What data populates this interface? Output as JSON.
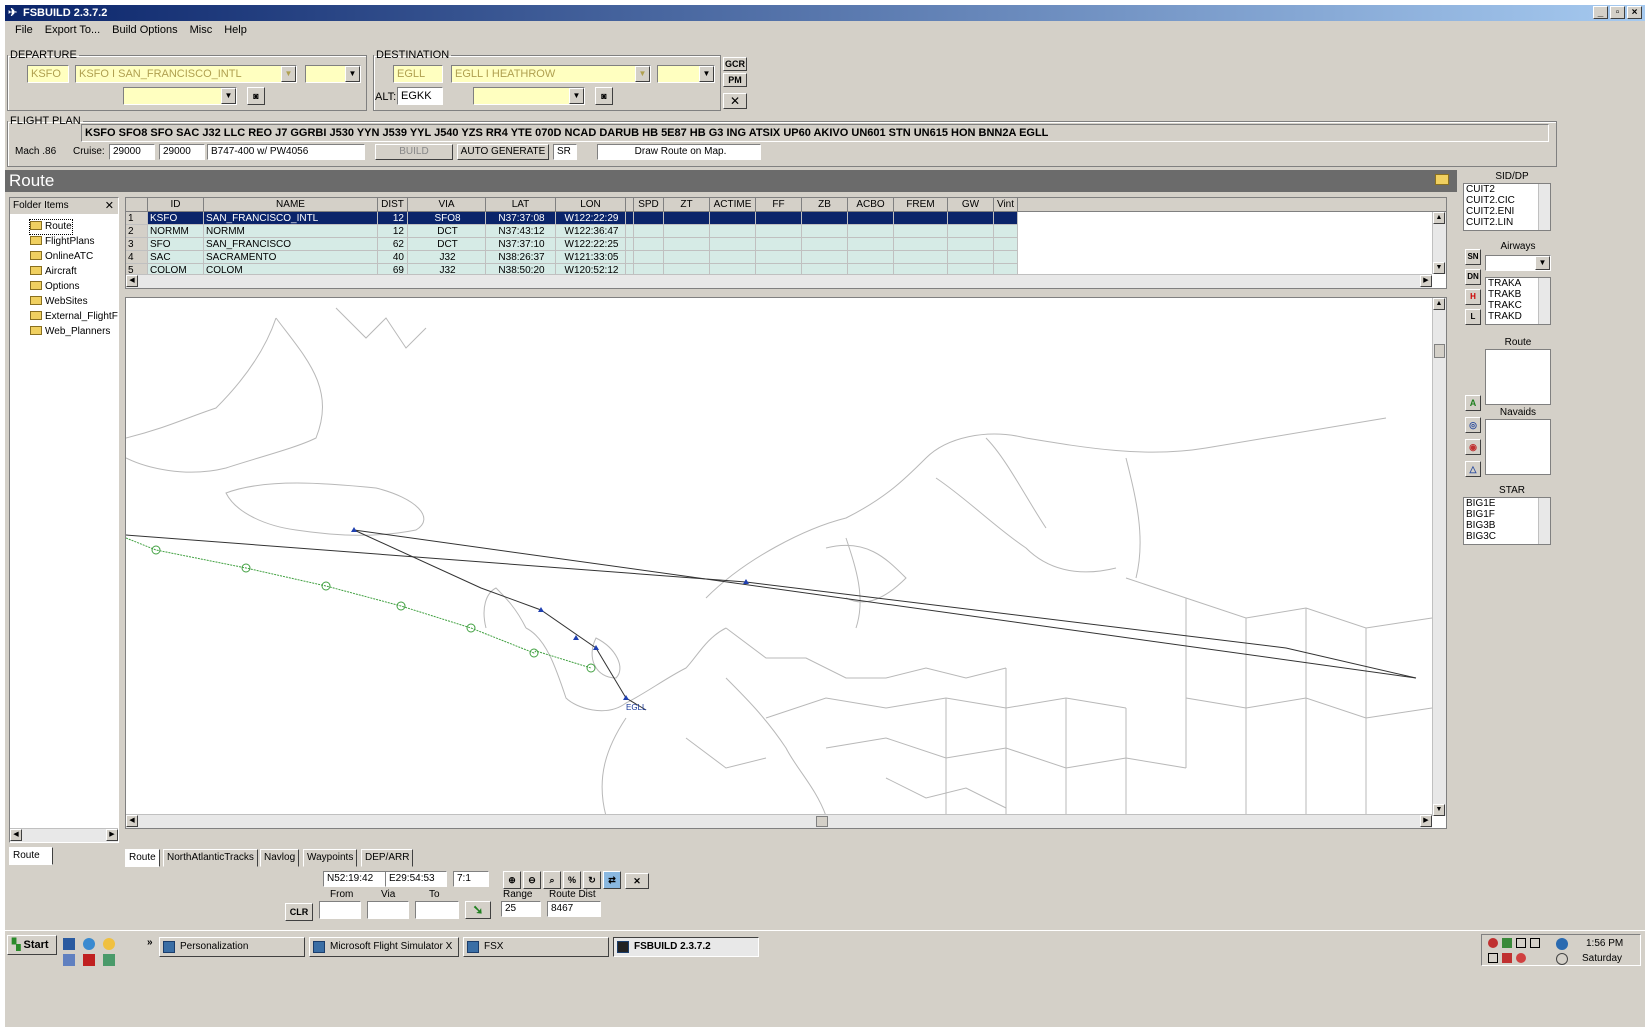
{
  "app": {
    "title": "FSBUILD 2.3.7.2"
  },
  "menu": [
    "File",
    "Export To...",
    "Build Options",
    "Misc",
    "Help"
  ],
  "departure": {
    "legend": "DEPARTURE",
    "icao": "KSFO",
    "airport": "KSFO I SAN_FRANCISCO_INTL",
    "runway": "",
    "alt_select": ""
  },
  "destination": {
    "legend": "DESTINATION",
    "icao": "EGLL",
    "airport": "EGLL I HEATHROW",
    "runway": "",
    "alt_label": "ALT:",
    "alt_value": "EGKK",
    "alt_select": ""
  },
  "side_buttons": {
    "gcr": "GCR",
    "pm": "PM"
  },
  "flight_plan": {
    "legend": "FLIGHT PLAN",
    "route": "KSFO SFO8 SFO  SAC J32 LLC REO J7 GGRBI J530 YYN J539 YYL J540 YZS RR4 YTE 070D NCAD DARUB HB 5E87 HB G3 ING ATSIX UP60 AKIVO UN601 STN UN615 HON BNN2A EGLL",
    "mach_label": "Mach .86",
    "cruise_label": "Cruise:",
    "cruise1": "29000",
    "cruise2": "29000",
    "aircraft": "B747-400 w/ PW4056",
    "build_label": "BUILD",
    "auto_label": "AUTO GENERATE",
    "sr": "SR",
    "draw_label": "Draw Route on Map."
  },
  "route_title": "Route",
  "folder": {
    "title": "Folder Items",
    "items": [
      "Route",
      "FlightPlans",
      "OnlineATC",
      "Aircraft",
      "Options",
      "WebSites",
      "External_FlightF",
      "Web_Planners"
    ]
  },
  "table": {
    "headers": [
      "ID",
      "NAME",
      "DIST",
      "VIA",
      "LAT",
      "LON",
      "SPD",
      "ZT",
      "ACTIME",
      "FF",
      "ZB",
      "ACBO",
      "FREM",
      "GW",
      "Vint"
    ],
    "rows": [
      {
        "n": "1",
        "id": "KSFO",
        "name": "SAN_FRANCISCO_INTL",
        "dist": "12",
        "via": "SFO8",
        "lat": "N37:37:08",
        "lon": "W122:22:29"
      },
      {
        "n": "2",
        "id": "NORMM",
        "name": "NORMM",
        "dist": "12",
        "via": "DCT",
        "lat": "N37:43:12",
        "lon": "W122:36:47"
      },
      {
        "n": "3",
        "id": "SFO",
        "name": "SAN_FRANCISCO",
        "dist": "62",
        "via": "DCT",
        "lat": "N37:37:10",
        "lon": "W122:22:25"
      },
      {
        "n": "4",
        "id": "SAC",
        "name": "SACRAMENTO",
        "dist": "40",
        "via": "J32",
        "lat": "N38:26:37",
        "lon": "W121:33:05"
      },
      {
        "n": "5",
        "id": "COLOM",
        "name": "COLOM",
        "dist": "69",
        "via": "J32",
        "lat": "N38:50:20",
        "lon": "W120:52:12"
      }
    ]
  },
  "map": {
    "dest_label": "EGLL"
  },
  "tabs": {
    "left": "Route",
    "bottom": [
      "Route",
      "NorthAtlanticTracks",
      "Navlog",
      "Waypoints",
      "DEP/ARR"
    ]
  },
  "status": {
    "lat": "N52:19:42",
    "lon": "E29:54:53",
    "scale": "7:1",
    "clr": "CLR",
    "from_label": "From",
    "via_label": "Via",
    "to_label": "To",
    "range_label": "Range",
    "range": "25",
    "routedist_label": "Route Dist",
    "routedist": "8467"
  },
  "right_panel": {
    "sid_title": "SID/DP",
    "sid": [
      "CUIT2",
      "CUIT2.CIC",
      "CUIT2.ENI",
      "CUIT2.LIN"
    ],
    "airways_title": "Airways",
    "tracks": [
      "TRAKA",
      "TRAKB",
      "TRAKC",
      "TRAKD"
    ],
    "btn_sn": "SN",
    "btn_dn": "DN",
    "btn_h": "H",
    "btn_l": "L",
    "btn_a": "A",
    "route_title": "Route",
    "navaids_title": "Navaids",
    "star_title": "STAR",
    "star": [
      "BIG1E",
      "BIG1F",
      "BIG3B",
      "BIG3C"
    ]
  },
  "taskbar": {
    "start": "Start",
    "items": [
      "Personalization",
      "Microsoft Flight Simulator X",
      "FSX",
      "FSBUILD 2.3.7.2"
    ],
    "time": "1:56 PM",
    "day": "Saturday"
  },
  "colors": {
    "title_start": "#0a246a",
    "title_end": "#a6caf0",
    "selection": "#0a246a",
    "row_alt": "#d6ebe6",
    "route_line": "#333333",
    "nat_track": "#40a040"
  }
}
